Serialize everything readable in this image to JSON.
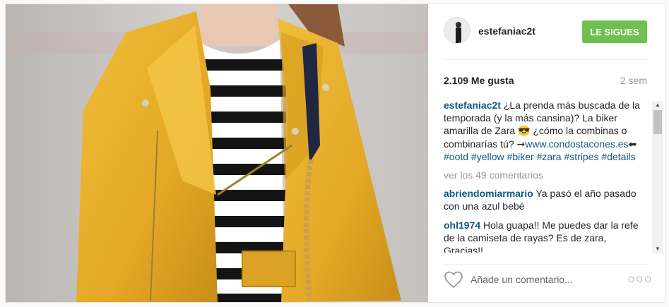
{
  "post": {
    "username": "estefaniac2t",
    "follow_label": "LE SIGUES",
    "likes": "2.109 Me gusta",
    "time_ago": "2 sem",
    "caption": {
      "user": "estefaniac2t",
      "text_1": "¿La prenda más buscada de la temporada (y la más cansina)? La biker amarilla de Zara",
      "emoji": "😎",
      "text_2": "¿cómo la combinas o combinarías tú?",
      "arrow_left": "➞",
      "link": "www.condostacones.es",
      "arrow_right": "⬅",
      "hashtags": [
        "#ootd",
        "#yellow",
        "#biker",
        "#zara",
        "#stripes",
        "#details"
      ]
    },
    "view_comments": "ver los 49 comentarios",
    "comments": [
      {
        "user": "abriendomiarmario",
        "text": "Ya pasó el año pasado con una azul bebé"
      },
      {
        "user": "ohl1974",
        "text": "Hola guapa!! Me puedes dar la refe de la camiseta de rayas? Es de zara, Gracias!!"
      }
    ],
    "add_comment_placeholder": "Añade un comentario...",
    "more_options": "○○○"
  },
  "icons": {
    "like": "heart-outline-icon",
    "options": "more-options-icon",
    "scroll_up": "scroll-up-arrow-icon",
    "scroll_down": "scroll-down-arrow-icon"
  },
  "colors": {
    "follow_button": "#70c050",
    "username_link": "#125688",
    "muted": "#999999",
    "jacket": "#e9b12e"
  }
}
